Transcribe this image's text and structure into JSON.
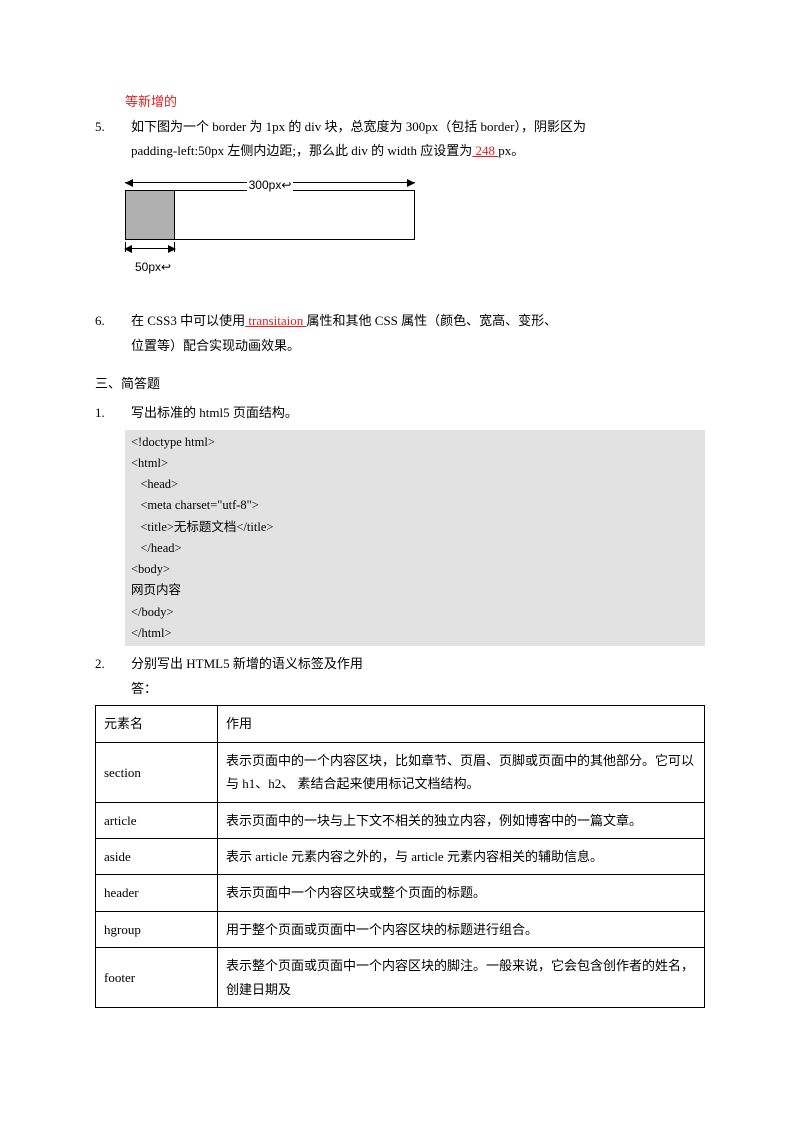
{
  "top_red": "等新增的",
  "q5": {
    "num": "5.",
    "line1a": "如下图为一个 border 为 1px   的 div 块，总宽度为 300px（包括 border），阴影区为",
    "line2a": "padding-left:50px 左侧内边距;，那么此 div 的 width 应设置为",
    "ans": "  248        ",
    "line2b": " px。"
  },
  "diagram": {
    "top": "300px↩",
    "bot": "50px↩"
  },
  "q6": {
    "num": "6.",
    "a": "在 CSS3 中可以使用",
    "ans": " transitaion         ",
    "b": "属性和其他 CSS 属性（颜色、宽高、变形、",
    "c": "位置等）配合实现动画效果。"
  },
  "sec3": "三、简答题",
  "sa1": {
    "num": "1.",
    "t": "写出标准的 html5 页面结构。"
  },
  "code": [
    "<!doctype html>",
    "<html>",
    "   <head>",
    "   <meta charset=\"utf-8\">",
    "   <title>无标题文档</title>",
    "   </head>",
    "<body>",
    "网页内容",
    "</body>",
    "</html>"
  ],
  "sa2": {
    "num": "2.",
    "t": "分别写出 HTML5 新增的语义标签及作用",
    "ans": "答："
  },
  "table": {
    "h1": "元素名",
    "h2": "作用",
    "rows": [
      [
        "section",
        "表示页面中的一个内容区块，比如章节、页眉、页脚或页面中的其他部分。它可以与 h1、h2、\n素结合起来使用标记文档结构。"
      ],
      [
        "article",
        "表示页面中的一块与上下文不相关的独立内容，例如博客中的一篇文章。"
      ],
      [
        "aside",
        "表示 article 元素内容之外的，与 article 元素内容相关的辅助信息。"
      ],
      [
        "header",
        "表示页面中一个内容区块或整个页面的标题。"
      ],
      [
        "hgroup",
        "用于整个页面或页面中一个内容区块的标题进行组合。"
      ],
      [
        "footer",
        "表示整个页面或页面中一个内容区块的脚注。一般来说，它会包含创作者的姓名，创建日期及"
      ]
    ]
  }
}
